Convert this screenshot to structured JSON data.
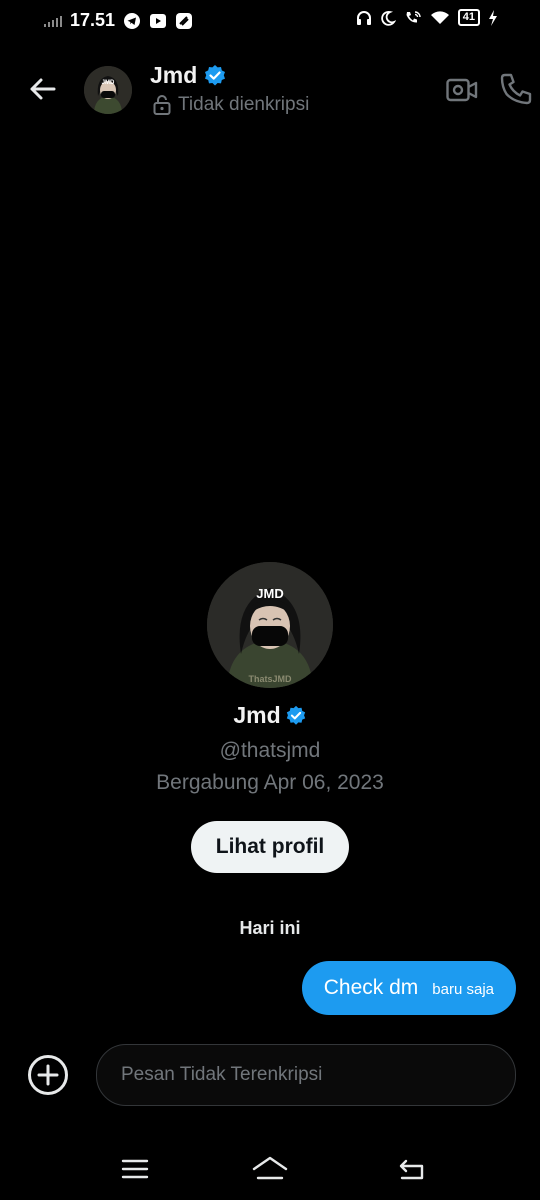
{
  "status_bar": {
    "time": "17.51",
    "battery": "41",
    "left_icons": [
      "signal-icon",
      "telegram-icon",
      "youtube-icon",
      "app-icon"
    ],
    "right_icons": [
      "headphones-icon",
      "moon-icon",
      "wifi-call-icon",
      "wifi-icon",
      "battery-icon",
      "charging-icon"
    ]
  },
  "header": {
    "name": "Jmd",
    "encryption_status": "Tidak dienkripsi",
    "icons": [
      "back-arrow-icon",
      "verified-badge-icon",
      "unlocked-icon",
      "video-call-icon",
      "phone-icon"
    ]
  },
  "profile": {
    "name": "Jmd",
    "handle": "@thatsjmd",
    "joined": "Bergabung Apr 06, 2023",
    "view_profile_label": "Lihat profil",
    "avatar_text_top": "JMD",
    "avatar_text_bottom": "ThatsJMD"
  },
  "conversation": {
    "date_separator": "Hari ini",
    "messages": [
      {
        "text": "Check dm",
        "time": "baru saja",
        "sent": true
      }
    ]
  },
  "composer": {
    "placeholder": "Pesan Tidak Terenkripsi",
    "value": ""
  },
  "colors": {
    "background": "#000000",
    "accent": "#1d9bf0",
    "muted_text": "#71767b",
    "button_bg": "#eff3f4"
  }
}
